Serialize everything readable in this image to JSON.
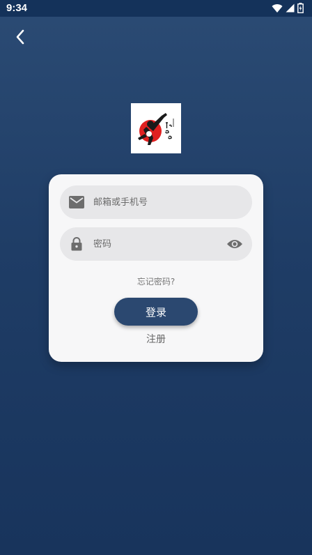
{
  "status_bar": {
    "time": "9:34",
    "icons": [
      "wifi-icon",
      "signal-icon",
      "battery-icon"
    ]
  },
  "nav": {
    "back_icon": "chevron-left-icon"
  },
  "login_form": {
    "email_placeholder": "邮箱或手机号",
    "password_placeholder": "密码",
    "forgot_password": "忘记密码?",
    "login_button": "登录",
    "register_link": "注册"
  },
  "colors": {
    "background_top": "#2b4b74",
    "background_bottom": "#18345c",
    "card": "#f7f7f8",
    "field": "#e7e7e9",
    "primary_button": "#2b4870"
  }
}
